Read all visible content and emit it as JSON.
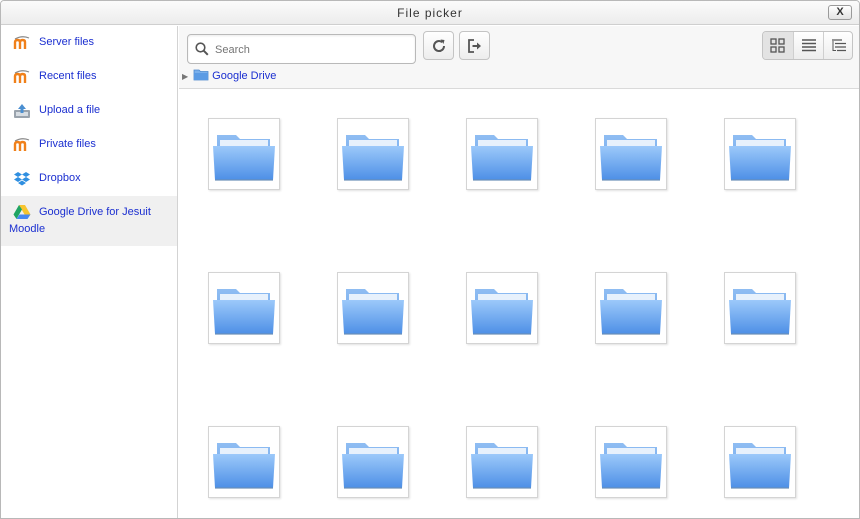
{
  "dialog": {
    "title": "File picker",
    "close_label": "X"
  },
  "sidebar": {
    "items": [
      {
        "label": "Server files",
        "icon": "moodle-icon"
      },
      {
        "label": "Recent files",
        "icon": "moodle-icon"
      },
      {
        "label": "Upload a file",
        "icon": "upload-icon"
      },
      {
        "label": "Private files",
        "icon": "moodle-icon"
      },
      {
        "label": "Dropbox",
        "icon": "dropbox-icon"
      },
      {
        "label": "Google Drive for Jesuit Moodle",
        "icon": "google-drive-icon",
        "active": true
      }
    ]
  },
  "toolbar": {
    "search_placeholder": "Search",
    "refresh_icon": "refresh-icon",
    "logout_icon": "logout-icon",
    "views": [
      "icon-view",
      "list-view",
      "tree-view"
    ],
    "active_view": "icon-view"
  },
  "path": {
    "label": "Google Drive"
  },
  "folders": {
    "count": 15,
    "icon": "folder-icon"
  },
  "colors": {
    "link": "#1b2fd0",
    "folder": "#5aa3f0",
    "active_bg": "#f0f0f0"
  }
}
